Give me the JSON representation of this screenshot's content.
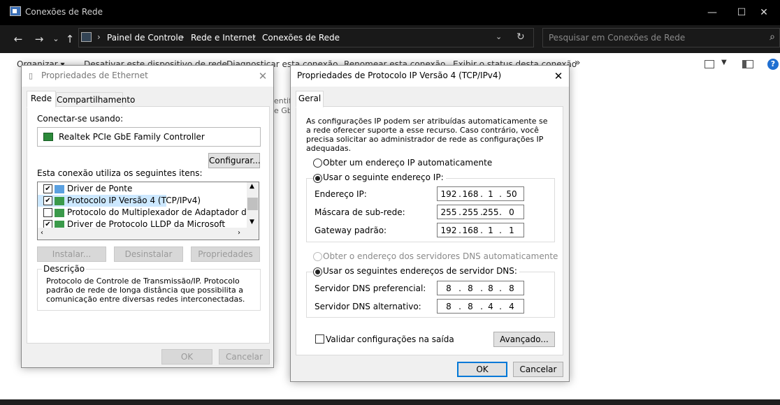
{
  "explorer": {
    "title": "Conexões de Rede",
    "window_buttons": {
      "minimize": "—",
      "maximize": "☐",
      "close": "✕"
    },
    "nav": {
      "back": "←",
      "forward": "→",
      "history": "⌄",
      "up": "↑"
    },
    "breadcrumbs": [
      "Painel de Controle",
      "Rede e Internet",
      "Conexões de Rede"
    ],
    "search_placeholder": "Pesquisar em Conexões de Rede",
    "command_bar": {
      "organize": "Organizar ▾",
      "disable": "Desativar este dispositivo de rede",
      "diagnose": "Diagnosticar esta conexão",
      "rename": "Renomear esta conexão",
      "status": "Exibir o status desta conexão",
      "more": "»"
    },
    "background_fragments": [
      "entif",
      "e Gb"
    ]
  },
  "ethernet_dialog": {
    "title": "Propriedades de Ethernet",
    "tabs": [
      "Rede",
      "Compartilhamento"
    ],
    "connect_using_label": "Conectar-se usando:",
    "adapter": "Realtek PCIe GbE Family Controller",
    "configure_button": "Configurar...",
    "items_label": "Esta conexão utiliza os seguintes itens:",
    "items": [
      {
        "label": "Driver de Ponte",
        "checked": true
      },
      {
        "label": "Protocolo IP Versão 4 (TCP/IPv4)",
        "checked": true,
        "selected": true
      },
      {
        "label": "Protocolo do Multiplexador de Adaptador de Rede da M",
        "checked": false
      },
      {
        "label": "Driver de Protocolo LLDP da Microsoft",
        "checked": true
      }
    ],
    "install_button": "Instalar...",
    "uninstall_button": "Desinstalar",
    "properties_button": "Propriedades",
    "description_label": "Descrição",
    "description_text": "Protocolo de Controle de Transmissão/IP. Protocolo padrão de rede de longa distância que possibilita a comunicação entre diversas redes interconectadas.",
    "ok_button": "OK",
    "cancel_button": "Cancelar"
  },
  "ipv4_dialog": {
    "title": "Propriedades de Protocolo IP Versão 4 (TCP/IPv4)",
    "tab": "Geral",
    "intro": "As configurações IP podem ser atribuídas automaticamente se a rede oferecer suporte a esse recurso. Caso contrário, você precisa solicitar ao administrador de rede as configurações IP adequadas.",
    "auto_ip_label": "Obter um endereço IP automaticamente",
    "manual_ip_label": "Usar o seguinte endereço IP:",
    "ip_address_label": "Endereço IP:",
    "ip_address": [
      "192",
      "168",
      "1",
      "50"
    ],
    "subnet_label": "Máscara de sub-rede:",
    "subnet": [
      "255",
      "255",
      "255",
      "0"
    ],
    "gateway_label": "Gateway padrão:",
    "gateway": [
      "192",
      "168",
      "1",
      "1"
    ],
    "auto_dns_label": "Obter o endereço dos servidores DNS automaticamente",
    "manual_dns_label": "Usar os seguintes endereços de servidor DNS:",
    "preferred_dns_label": "Servidor DNS preferencial:",
    "preferred_dns": [
      "8",
      "8",
      "8",
      "8"
    ],
    "alternate_dns_label": "Servidor DNS alternativo:",
    "alternate_dns": [
      "8",
      "8",
      "4",
      "4"
    ],
    "validate_label": "Validar configurações na saída",
    "advanced_button": "Avançado...",
    "ok_button": "OK",
    "cancel_button": "Cancelar"
  }
}
